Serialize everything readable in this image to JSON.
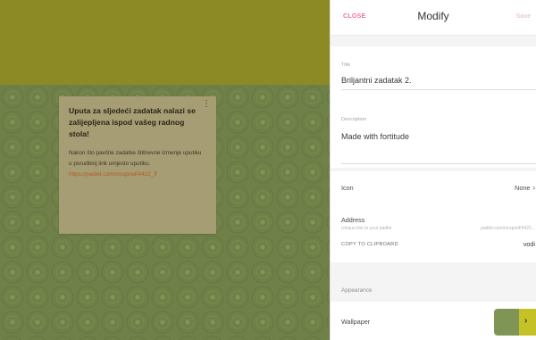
{
  "post": {
    "title": "Uputa za sljedeći zadatak nalazi se zalijepljena ispod vašeg radnog stola!",
    "body": "Nakon što pavčite zadatke štitnevne izmenje uputiku u porudbinj link umjesto uputiku.",
    "link": "https://padlet.com/mrupnef/4422_ff",
    "menu_icon": "more-vert-icon"
  },
  "panel": {
    "close_label": "CLOSE",
    "title": "Modify",
    "save_label": "Save",
    "title_field": {
      "label": "Title",
      "value": "Briljantni zadatak 2."
    },
    "description_field": {
      "label": "Description",
      "value": "Made with fortitude"
    },
    "icon_row": {
      "label": "Icon",
      "value": "None"
    },
    "address": {
      "label": "Address",
      "sub_label": "Unique link to your padlet",
      "url": "padlet.com/mrupnef/4422...",
      "copy_label": "COPY TO CLIPBOARD",
      "end_value": "vodi"
    },
    "appearance_label": "Appearance",
    "wallpaper_label": "Wallpaper"
  },
  "colors": {
    "canvas_top": "#8c8a24",
    "wallpaper": "#6f8048",
    "post_bg": "#a69d74",
    "accent": "#e8739a"
  }
}
